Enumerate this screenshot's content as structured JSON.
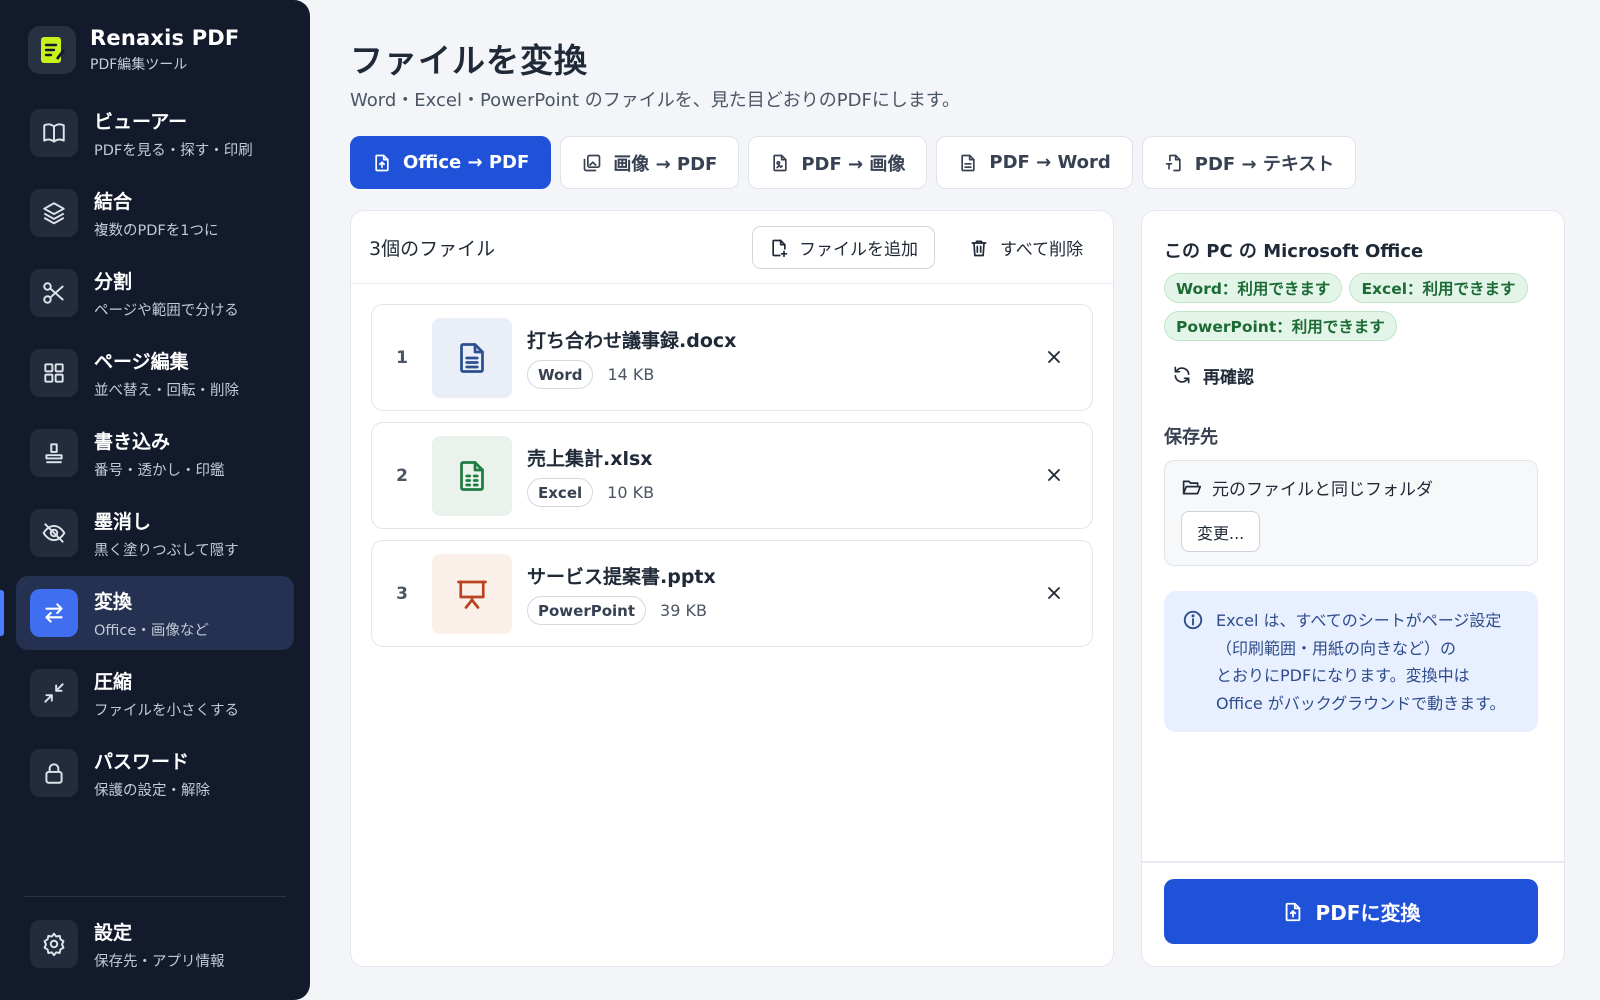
{
  "app": {
    "name": "Renaxis PDF",
    "subtitle": "PDF編集ツール"
  },
  "sidebar": {
    "items": [
      {
        "title": "ビューアー",
        "desc": "PDFを見る・探す・印刷",
        "icon": "book-icon"
      },
      {
        "title": "結合",
        "desc": "複数のPDFを1つに",
        "icon": "layers-icon"
      },
      {
        "title": "分割",
        "desc": "ページや範囲で分ける",
        "icon": "scissors-icon"
      },
      {
        "title": "ページ編集",
        "desc": "並べ替え・回転・削除",
        "icon": "grid-icon"
      },
      {
        "title": "書き込み",
        "desc": "番号・透かし・印鑑",
        "icon": "stamp-icon"
      },
      {
        "title": "墨消し",
        "desc": "黒く塗りつぶして隠す",
        "icon": "eye-off-icon"
      },
      {
        "title": "変換",
        "desc": "Office・画像など",
        "icon": "swap-icon",
        "active": true
      },
      {
        "title": "圧縮",
        "desc": "ファイルを小さくする",
        "icon": "compress-icon"
      },
      {
        "title": "パスワード",
        "desc": "保護の設定・解除",
        "icon": "lock-icon"
      }
    ],
    "settings": {
      "title": "設定",
      "desc": "保存先・アプリ情報",
      "icon": "gear-icon"
    }
  },
  "page": {
    "title": "ファイルを変換",
    "subtitle": "Word・Excel・PowerPoint のファイルを、見た目どおりのPDFにします。"
  },
  "tabs": [
    {
      "label": "Office → PDF",
      "active": true
    },
    {
      "label": "画像 → PDF"
    },
    {
      "label": "PDF → 画像"
    },
    {
      "label": "PDF → Word"
    },
    {
      "label": "PDF → テキスト"
    }
  ],
  "file_panel": {
    "count_label": "3個のファイル",
    "add_label": "ファイルを追加",
    "clear_label": "すべて削除",
    "files": [
      {
        "num": "1",
        "name": "打ち合わせ議事録.docx",
        "type": "Word",
        "size": "14 KB"
      },
      {
        "num": "2",
        "name": "売上集計.xlsx",
        "type": "Excel",
        "size": "10 KB"
      },
      {
        "num": "3",
        "name": "サービス提案書.pptx",
        "type": "PowerPoint",
        "size": "39 KB"
      }
    ]
  },
  "side_panel": {
    "office_title": "この PC の Microsoft Office",
    "status": [
      "Word：利用できます",
      "Excel：利用できます",
      "PowerPoint：利用できます"
    ],
    "recheck_label": "再確認",
    "save_label": "保存先",
    "save_path": "元のファイルと同じフォルダ",
    "change_label": "変更...",
    "info_lines": [
      "Excel は、すべてのシートがページ設定",
      "（印刷範囲・用紙の向きなど）の",
      "とおりにPDFになります。変換中は",
      "Office がバックグラウンドで動きます。"
    ],
    "convert_label": "PDFに変換"
  },
  "colors": {
    "accent": "#2052d9",
    "sidebar_bg": "#121a2b",
    "success_text": "#1c6b34",
    "info_bg": "#e8efff"
  }
}
